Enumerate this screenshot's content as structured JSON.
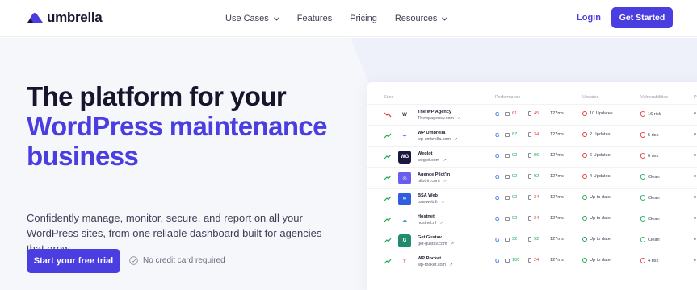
{
  "header": {
    "logo_text": "umbrella",
    "nav": [
      {
        "label": "Use Cases",
        "dropdown": true
      },
      {
        "label": "Features",
        "dropdown": false
      },
      {
        "label": "Pricing",
        "dropdown": false
      },
      {
        "label": "Resources",
        "dropdown": true
      }
    ],
    "login_label": "Login",
    "cta_label": "Get Started"
  },
  "hero": {
    "title_line1": "The platform for your",
    "title_accent": "WordPress maintenance business",
    "subtitle": "Confidently manage, monitor, secure, and report on all your WordPress sites, from one reliable dashboard built for agencies that grow.",
    "cta_label": "Start your free trial",
    "note": "No credit card required"
  },
  "colors": {
    "accent": "#4b3ee0",
    "good": "#1fa855",
    "bad": "#e23c3c"
  },
  "dashboard": {
    "columns": {
      "sites": "Sites",
      "performance": "Performance",
      "updates": "Updates",
      "vulnerabilities": "Vulnerabilities",
      "extra": "P"
    },
    "rows": [
      {
        "trend": "down",
        "icon": "wp-agency-icon",
        "icon_text": "W",
        "icon_bg": "#ffffff",
        "icon_fg": "#2a2a3a",
        "name": "The WP Agency",
        "url": "Thewpagency.com",
        "desktop": "61",
        "desktop_status": "bad",
        "mobile": "45",
        "mobile_status": "bad",
        "time": "127ms",
        "updates": "10 Updates",
        "updates_status": "bad",
        "vuln": "16 risk",
        "vuln_status": "bad",
        "extra": "e"
      },
      {
        "trend": "up",
        "icon": "umbrella-icon",
        "icon_text": "☂",
        "icon_bg": "#ffffff",
        "icon_fg": "#4b3ee0",
        "name": "WP Umbrella",
        "url": "wp-umbrella.com",
        "desktop": "87",
        "desktop_status": "good",
        "mobile": "34",
        "mobile_status": "bad",
        "time": "127ms",
        "updates": "2 Updates",
        "updates_status": "bad",
        "vuln": "5 risk",
        "vuln_status": "bad",
        "extra": "e"
      },
      {
        "trend": "up",
        "icon": "weglot-icon",
        "icon_text": "WG",
        "icon_bg": "#1a1840",
        "icon_fg": "#ffffff",
        "name": "Weglot",
        "url": "weglot.com",
        "desktop": "92",
        "desktop_status": "good",
        "mobile": "96",
        "mobile_status": "good",
        "time": "127ms",
        "updates": "6 Updates",
        "updates_status": "bad",
        "vuln": "6 risk",
        "vuln_status": "bad",
        "extra": "e"
      },
      {
        "trend": "up",
        "icon": "pilotin-icon",
        "icon_text": "◎",
        "icon_bg": "#6b5cf0",
        "icon_fg": "#ffffff",
        "name": "Agence Pilot'in",
        "url": "pilot-in.com",
        "desktop": "92",
        "desktop_status": "good",
        "mobile": "92",
        "mobile_status": "good",
        "time": "127ms",
        "updates": "4 Updates",
        "updates_status": "bad",
        "vuln": "Clean",
        "vuln_status": "good",
        "extra": "e"
      },
      {
        "trend": "up",
        "icon": "bsa-web-icon",
        "icon_text": "∞",
        "icon_bg": "#2f5fe0",
        "icon_fg": "#ffffff",
        "name": "BSA Web",
        "url": "bsa-web.fr",
        "desktop": "92",
        "desktop_status": "good",
        "mobile": "24",
        "mobile_status": "bad",
        "time": "127ms",
        "updates": "Up to date",
        "updates_status": "good",
        "vuln": "Clean",
        "vuln_status": "good",
        "extra": "e"
      },
      {
        "trend": "up",
        "icon": "hostnet-icon",
        "icon_text": "☁",
        "icon_bg": "#ffffff",
        "icon_fg": "#2aa0e0",
        "name": "Hostnet",
        "url": "hostnet.nl",
        "desktop": "92",
        "desktop_status": "good",
        "mobile": "24",
        "mobile_status": "bad",
        "time": "127ms",
        "updates": "Up to date",
        "updates_status": "good",
        "vuln": "Clean",
        "vuln_status": "good",
        "extra": "e"
      },
      {
        "trend": "up",
        "icon": "get-gustav-icon",
        "icon_text": "G",
        "icon_bg": "#1f8a6e",
        "icon_fg": "#ffffff",
        "name": "Get Gustav",
        "url": "get-gustav.com",
        "desktop": "92",
        "desktop_status": "good",
        "mobile": "92",
        "mobile_status": "good",
        "time": "127ms",
        "updates": "Up to date",
        "updates_status": "good",
        "vuln": "Clean",
        "vuln_status": "good",
        "extra": "e"
      },
      {
        "trend": "up",
        "icon": "wp-rocket-icon",
        "icon_text": "Y",
        "icon_bg": "#ffffff",
        "icon_fg": "#e0503c",
        "name": "WP Rocket",
        "url": "wp-rocket.com",
        "desktop": "100",
        "desktop_status": "good",
        "mobile": "24",
        "mobile_status": "bad",
        "time": "127ms",
        "updates": "Up to date",
        "updates_status": "good",
        "vuln": "4 risk",
        "vuln_status": "bad",
        "extra": "e"
      }
    ]
  }
}
